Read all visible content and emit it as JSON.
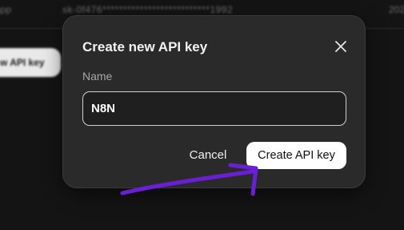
{
  "background": {
    "app_fragment": "app",
    "key_masked": "sk-0f476**************************1992",
    "date_fragment": "202",
    "create_button_fragment": "w API key"
  },
  "modal": {
    "title": "Create new API key",
    "close_icon": "close-icon",
    "name_label": "Name",
    "name_value": "N8N",
    "cancel_label": "Cancel",
    "create_label": "Create API key"
  },
  "annotation": {
    "arrow_color": "#6a1fd6"
  },
  "colors": {
    "modal_bg": "#2a2a2a",
    "page_bg": "#141414",
    "primary_button": "#ffffff"
  }
}
